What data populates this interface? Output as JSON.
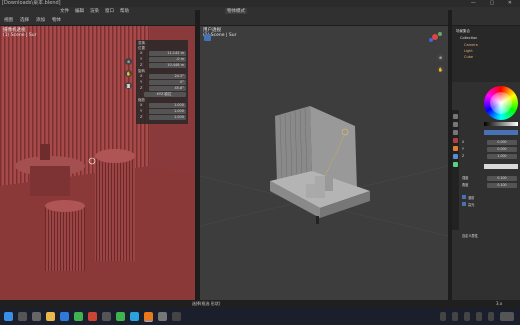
{
  "window": {
    "title": "[Downloads\\桌本.blend]",
    "controls": "— ▢ ✕"
  },
  "top_menu": [
    "文件",
    "编辑",
    "渲染",
    "窗口",
    "帮助"
  ],
  "left_viewport": {
    "mode_label": "物体模式",
    "view_menu": [
      "视图",
      "选择",
      "添加",
      "物体"
    ],
    "view_name": "摄像机透视",
    "collection_label": "(1) Scene | Sur",
    "npanel": {
      "tab": "项目",
      "transform_header": "变换",
      "location_header": "位置",
      "loc": [
        [
          "X",
          "11.142 m"
        ],
        [
          "Y",
          "-0 m"
        ],
        [
          "Z",
          "10.446 m"
        ]
      ],
      "rotation_header": "旋转",
      "rot": [
        [
          "X",
          "24.3°"
        ],
        [
          "Y",
          "0°"
        ],
        [
          "Z",
          "45.8°"
        ]
      ],
      "mode": "XYZ 欧拉",
      "scale_header": "缩放",
      "scale": [
        [
          "X",
          "1.000"
        ],
        [
          "Y",
          "1.000"
        ],
        [
          "Z",
          "1.000"
        ]
      ]
    }
  },
  "mid_viewport": {
    "view_name": "用户透视",
    "collection_label": "(1) Scene | Sur"
  },
  "outliner": {
    "items": [
      "场景集合",
      "Collection",
      "Camera",
      "Light",
      "Cube"
    ]
  },
  "properties": {
    "rows": [
      {
        "label": "X",
        "value": "0.000"
      },
      {
        "label": "Y",
        "value": "0.000"
      },
      {
        "label": "Z",
        "value": "1.000"
      },
      {
        "label": "强度",
        "value": "0.100"
      },
      {
        "label": "角度",
        "value": "0.100"
      }
    ],
    "checkboxes": [
      "漫射",
      "高光"
    ],
    "section": "自定义属性"
  },
  "status_bar": {
    "center": "选择(框选 形状)",
    "right": "3.x"
  },
  "colors": {
    "accent": "#4772b3",
    "red_overlay": "#8e3c3c",
    "light_line": "#d8b040"
  }
}
